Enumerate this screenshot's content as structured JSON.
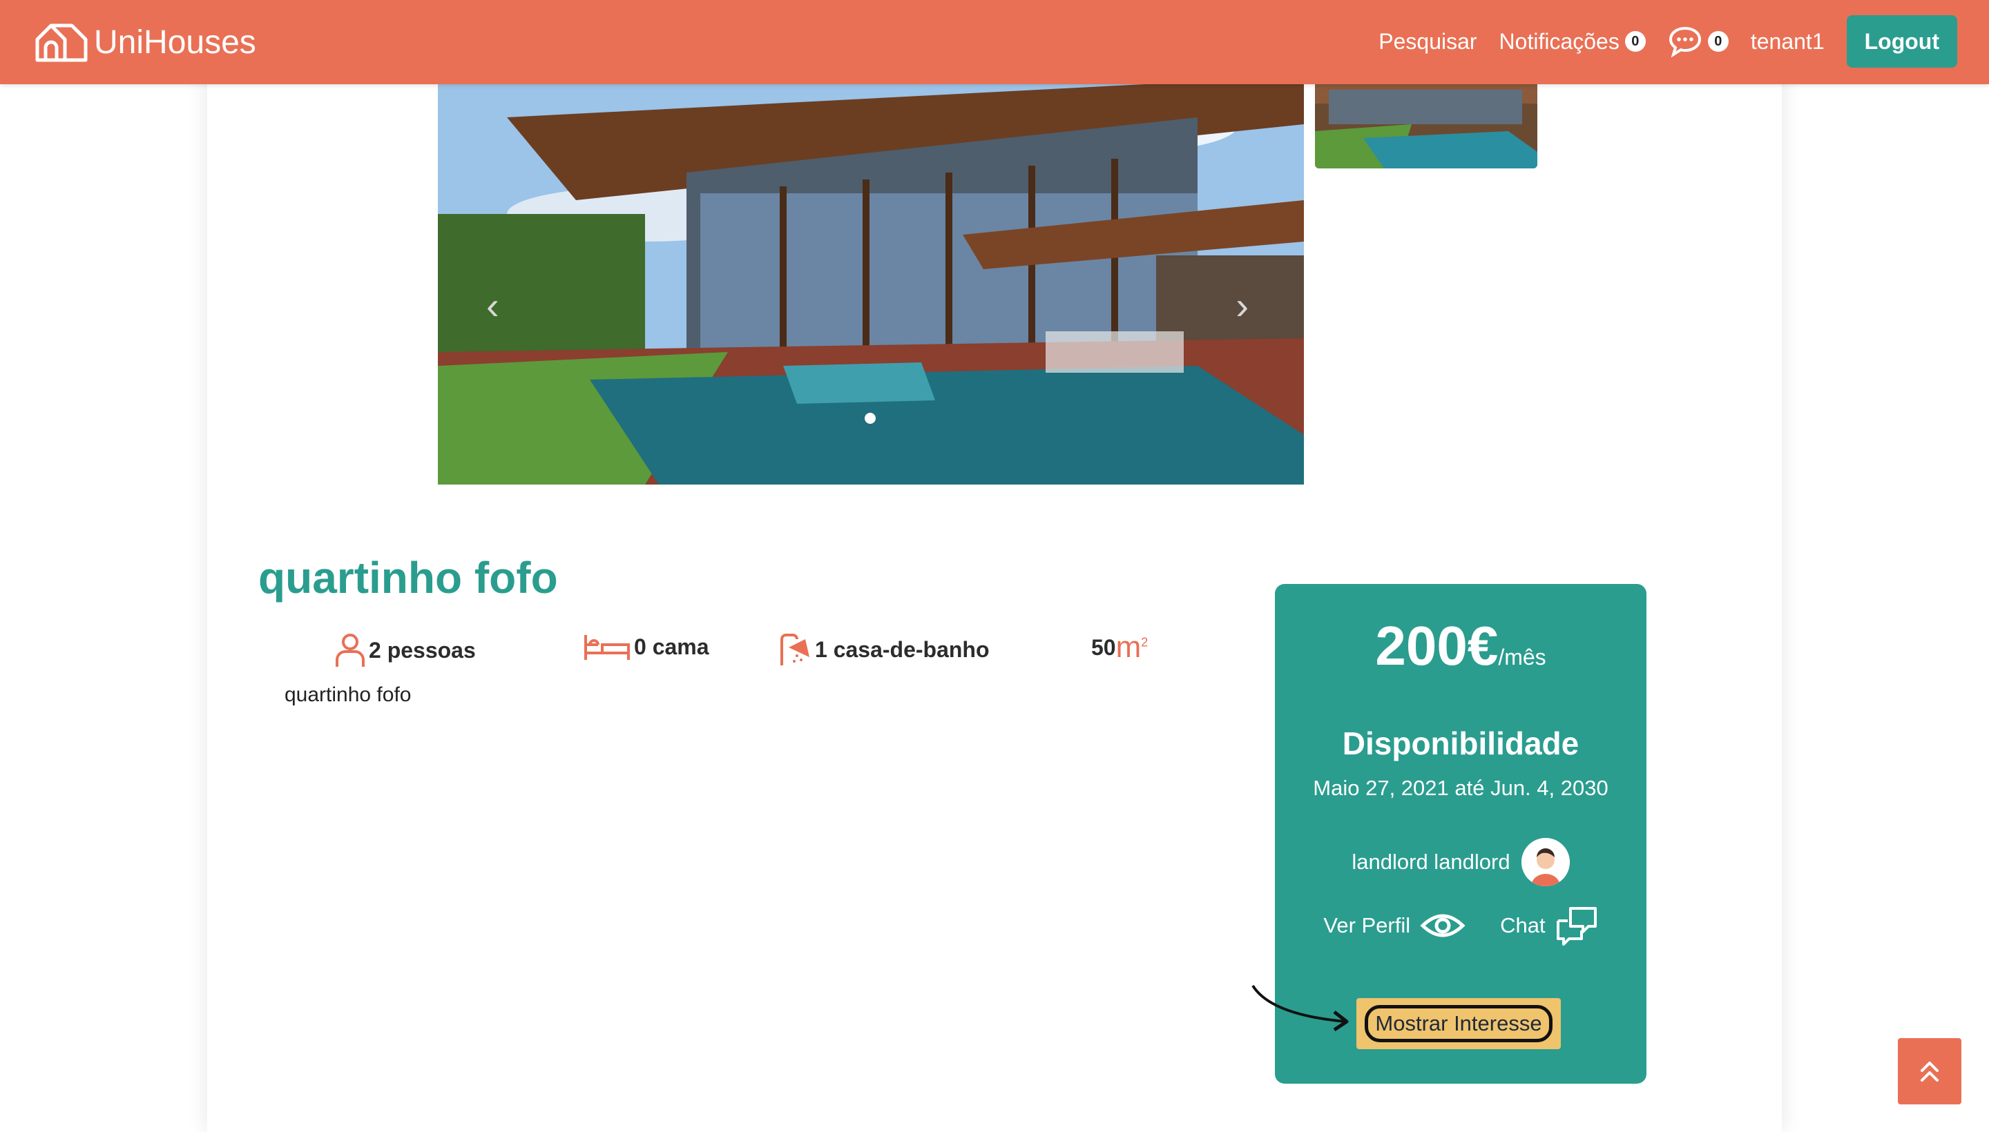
{
  "navbar": {
    "brand": "UniHouses",
    "search_label": "Pesquisar",
    "notifications_label": "Notificações",
    "notifications_count": "0",
    "messages_count": "0",
    "username": "tenant1",
    "logout_label": "Logout"
  },
  "listing": {
    "title": "quartinho fofo",
    "people": "2 pessoas",
    "beds": "0 cama",
    "bathrooms": "1 casa-de-banho",
    "area": "50",
    "description": "quartinho fofo"
  },
  "card": {
    "price": "200€",
    "price_period": "/mês",
    "availability_title": "Disponibilidade",
    "availability_dates": "Maio 27, 2021 até Jun. 4, 2030",
    "landlord_name": "landlord landlord",
    "view_profile_label": "Ver Perfil",
    "chat_label": "Chat",
    "interest_label": "Mostrar Interesse"
  },
  "carousel": {
    "prev_glyph": "‹",
    "next_glyph": "›"
  },
  "colors": {
    "brand": "#e97055",
    "accent": "#2a9d8f",
    "interest_button": "#f0c36d"
  },
  "icons": [
    "home-logo-icon",
    "chat-bubble-icon",
    "person-icon",
    "bed-icon",
    "shower-icon",
    "area-m2-icon",
    "eye-icon",
    "chat-icon",
    "arrow-up-double-icon"
  ]
}
